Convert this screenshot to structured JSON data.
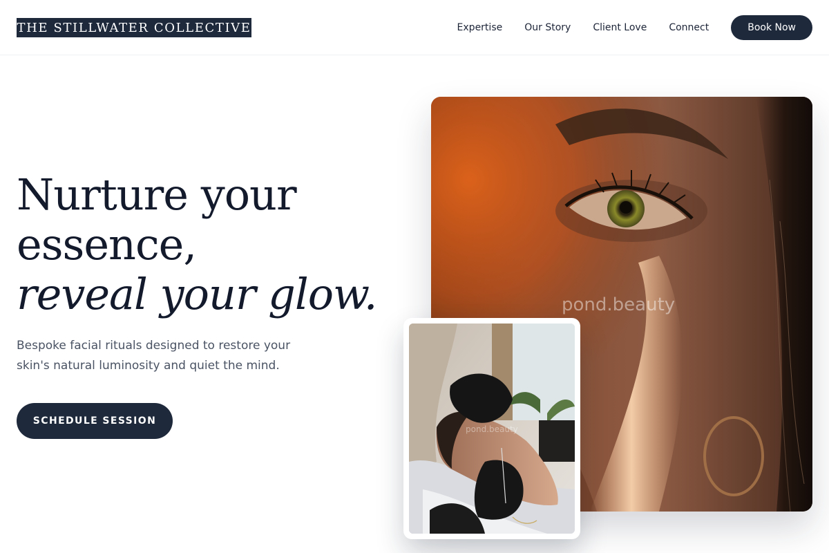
{
  "header": {
    "logo_text": "THE STILLWATER COLLECTIVE",
    "nav": [
      {
        "label": "Expertise"
      },
      {
        "label": "Our Story"
      },
      {
        "label": "Client Love"
      },
      {
        "label": "Connect"
      }
    ],
    "cta_label": "Book Now"
  },
  "hero": {
    "title_line1": "Nurture your",
    "title_line2": "essence,",
    "title_line3_italic": "reveal your glow.",
    "subtitle": "Bespoke facial rituals designed to restore your skin's natural luminosity and quiet the mind.",
    "cta_label": "SCHEDULE SESSION"
  },
  "images": {
    "main_watermark": "pond.beauty",
    "secondary_watermark": "pond.beauty"
  },
  "colors": {
    "primary": "#1e293b",
    "heading": "#131a2c",
    "body_text": "#4a5363",
    "background": "#ffffff"
  }
}
